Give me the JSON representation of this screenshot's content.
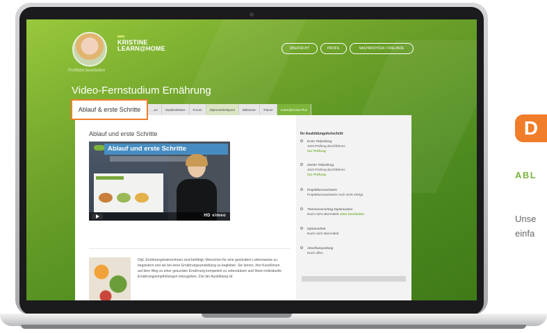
{
  "header": {
    "brand_line1": "KRISTINE",
    "brand_line2": "LEARN@HOME",
    "profile_edit": "Profilbild bearbeiten",
    "nav": [
      {
        "label": "ÜBERSICHT"
      },
      {
        "label": "PROFIL"
      },
      {
        "label": "NACHRICHTEN / FREUNDE"
      }
    ]
  },
  "page_title": "Video-Fernstudium Ernährung",
  "tabs": {
    "active": "Ablauf & erste Schritte",
    "items": [
      {
        "label": "...en"
      },
      {
        "label": "Studienlektüre"
      },
      {
        "label": "Forum"
      },
      {
        "label": "Diplomarbeitspool"
      },
      {
        "label": "Webinare"
      },
      {
        "label": "Trainer"
      },
      {
        "label": "Learn@Home Plus"
      }
    ]
  },
  "main": {
    "section_title": "Ablauf und erste Schritte",
    "video": {
      "overlay_title": "Ablauf und erste Schritte",
      "brand": "vimeo",
      "hd": "HD"
    },
    "description": "Dipl. Ernährungstrainer/innen sind befähigt, Menschen für eine gesündere Lebensweise zu begeistern und sie bei einer Ernährungsumstellung zu begleiten. Sie lernen, Ihre Kund/innen auf dem Weg zu einer gesunden Ernährung kompetent zu unterstützen und Ihnen individuelle Ernährungsempfehlungen mitzugeben. Ziel der Ausbildung ist"
  },
  "sidebar": {
    "title": "Ihr Ausbildungsfortschritt",
    "steps": [
      {
        "title": "Erste Teilprüfung",
        "line2": "Jetzt Prüfung durchführen:",
        "link": "Zur Prüfung"
      },
      {
        "title": "Zweite Teilprüfung",
        "line2": "Jetzt Prüfung durchführen:",
        "link": "Zur Prüfung"
      },
      {
        "title": "Projektkursnachweis",
        "line2": "Projektkursnachweis noch nicht erfolgt",
        "link": ""
      },
      {
        "title": "Themenvorschlag Diplomarbeit",
        "line2": "Noch nicht übermittelt",
        "link": "Jetzt hochladen"
      },
      {
        "title": "Diplomarbeit",
        "line2": "Noch nicht übermittelt",
        "link": ""
      },
      {
        "title": "Abschlussprüfung",
        "line2": "Noch offen",
        "link": ""
      }
    ]
  },
  "right_panel": {
    "badge_letter": "D",
    "heading": "ABL",
    "text_line1": "Unse",
    "text_line2": "einfa"
  },
  "colors": {
    "accent_green": "#7ab33c",
    "accent_orange": "#f07d2a"
  }
}
